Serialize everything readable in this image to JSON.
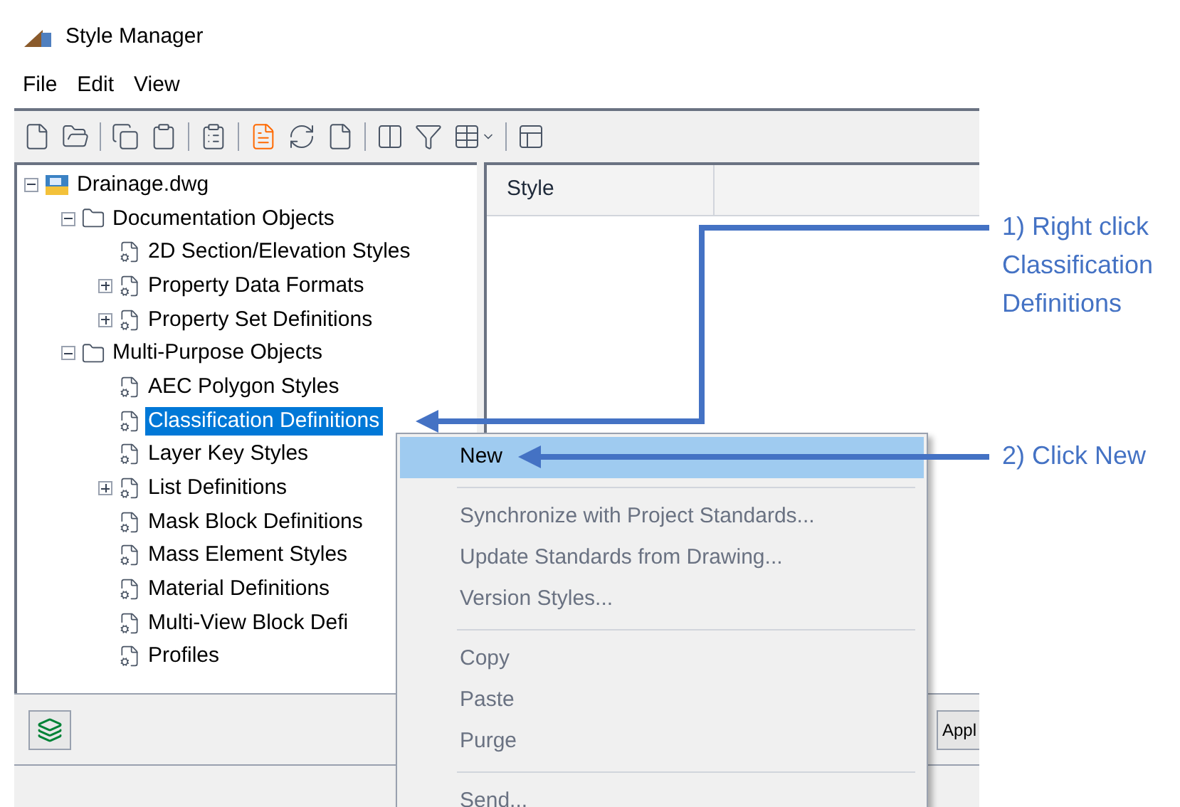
{
  "window": {
    "title": "Style Manager"
  },
  "menu_bar": [
    "File",
    "Edit",
    "View"
  ],
  "tree": [
    {
      "label": "Drainage.dwg",
      "kind": "drawing",
      "expanded": true,
      "selected": false,
      "children": [
        {
          "label": "Documentation Objects",
          "kind": "folder",
          "expanded": true,
          "selected": false,
          "children": [
            {
              "label": "2D Section/Elevation Styles",
              "kind": "style",
              "selected": false
            },
            {
              "label": "Property Data Formats",
              "kind": "style",
              "expanded": false,
              "selected": false
            },
            {
              "label": "Property Set Definitions",
              "kind": "style",
              "expanded": false,
              "selected": false
            }
          ]
        },
        {
          "label": "Multi-Purpose Objects",
          "kind": "folder",
          "expanded": true,
          "selected": false,
          "children": [
            {
              "label": "AEC Polygon Styles",
              "kind": "style",
              "selected": false
            },
            {
              "label": "Classification Definitions",
              "kind": "style",
              "selected": true
            },
            {
              "label": "Layer Key Styles",
              "kind": "style",
              "selected": false
            },
            {
              "label": "List Definitions",
              "kind": "style",
              "expanded": false,
              "selected": false
            },
            {
              "label": "Mask Block Definitions",
              "kind": "style",
              "selected": false
            },
            {
              "label": "Mass Element Styles",
              "kind": "style",
              "selected": false
            },
            {
              "label": "Material Definitions",
              "kind": "style",
              "selected": false
            },
            {
              "label": "Multi-View Block Defi",
              "kind": "style",
              "selected": false
            },
            {
              "label": "Profiles",
              "kind": "style",
              "selected": false
            }
          ]
        }
      ]
    }
  ],
  "list": {
    "columns": [
      "Style"
    ]
  },
  "footer": {
    "apply_button": "Appl"
  },
  "context_menu": {
    "groups": [
      [
        {
          "label": "New",
          "disabled": false,
          "selected": true
        }
      ],
      [
        {
          "label": "Synchronize with Project Standards...",
          "disabled": true,
          "selected": false
        },
        {
          "label": "Update Standards from Drawing...",
          "disabled": true,
          "selected": false
        },
        {
          "label": "Version Styles...",
          "disabled": true,
          "selected": false
        }
      ],
      [
        {
          "label": "Copy",
          "disabled": true,
          "selected": false
        },
        {
          "label": "Paste",
          "disabled": true,
          "selected": false
        },
        {
          "label": "Purge",
          "disabled": true,
          "selected": false
        }
      ],
      [
        {
          "label": "Send...",
          "disabled": true,
          "selected": false
        }
      ]
    ]
  },
  "annotations": [
    {
      "text": "1) Right click Classification Definitions"
    },
    {
      "text": "2) Click New"
    }
  ]
}
